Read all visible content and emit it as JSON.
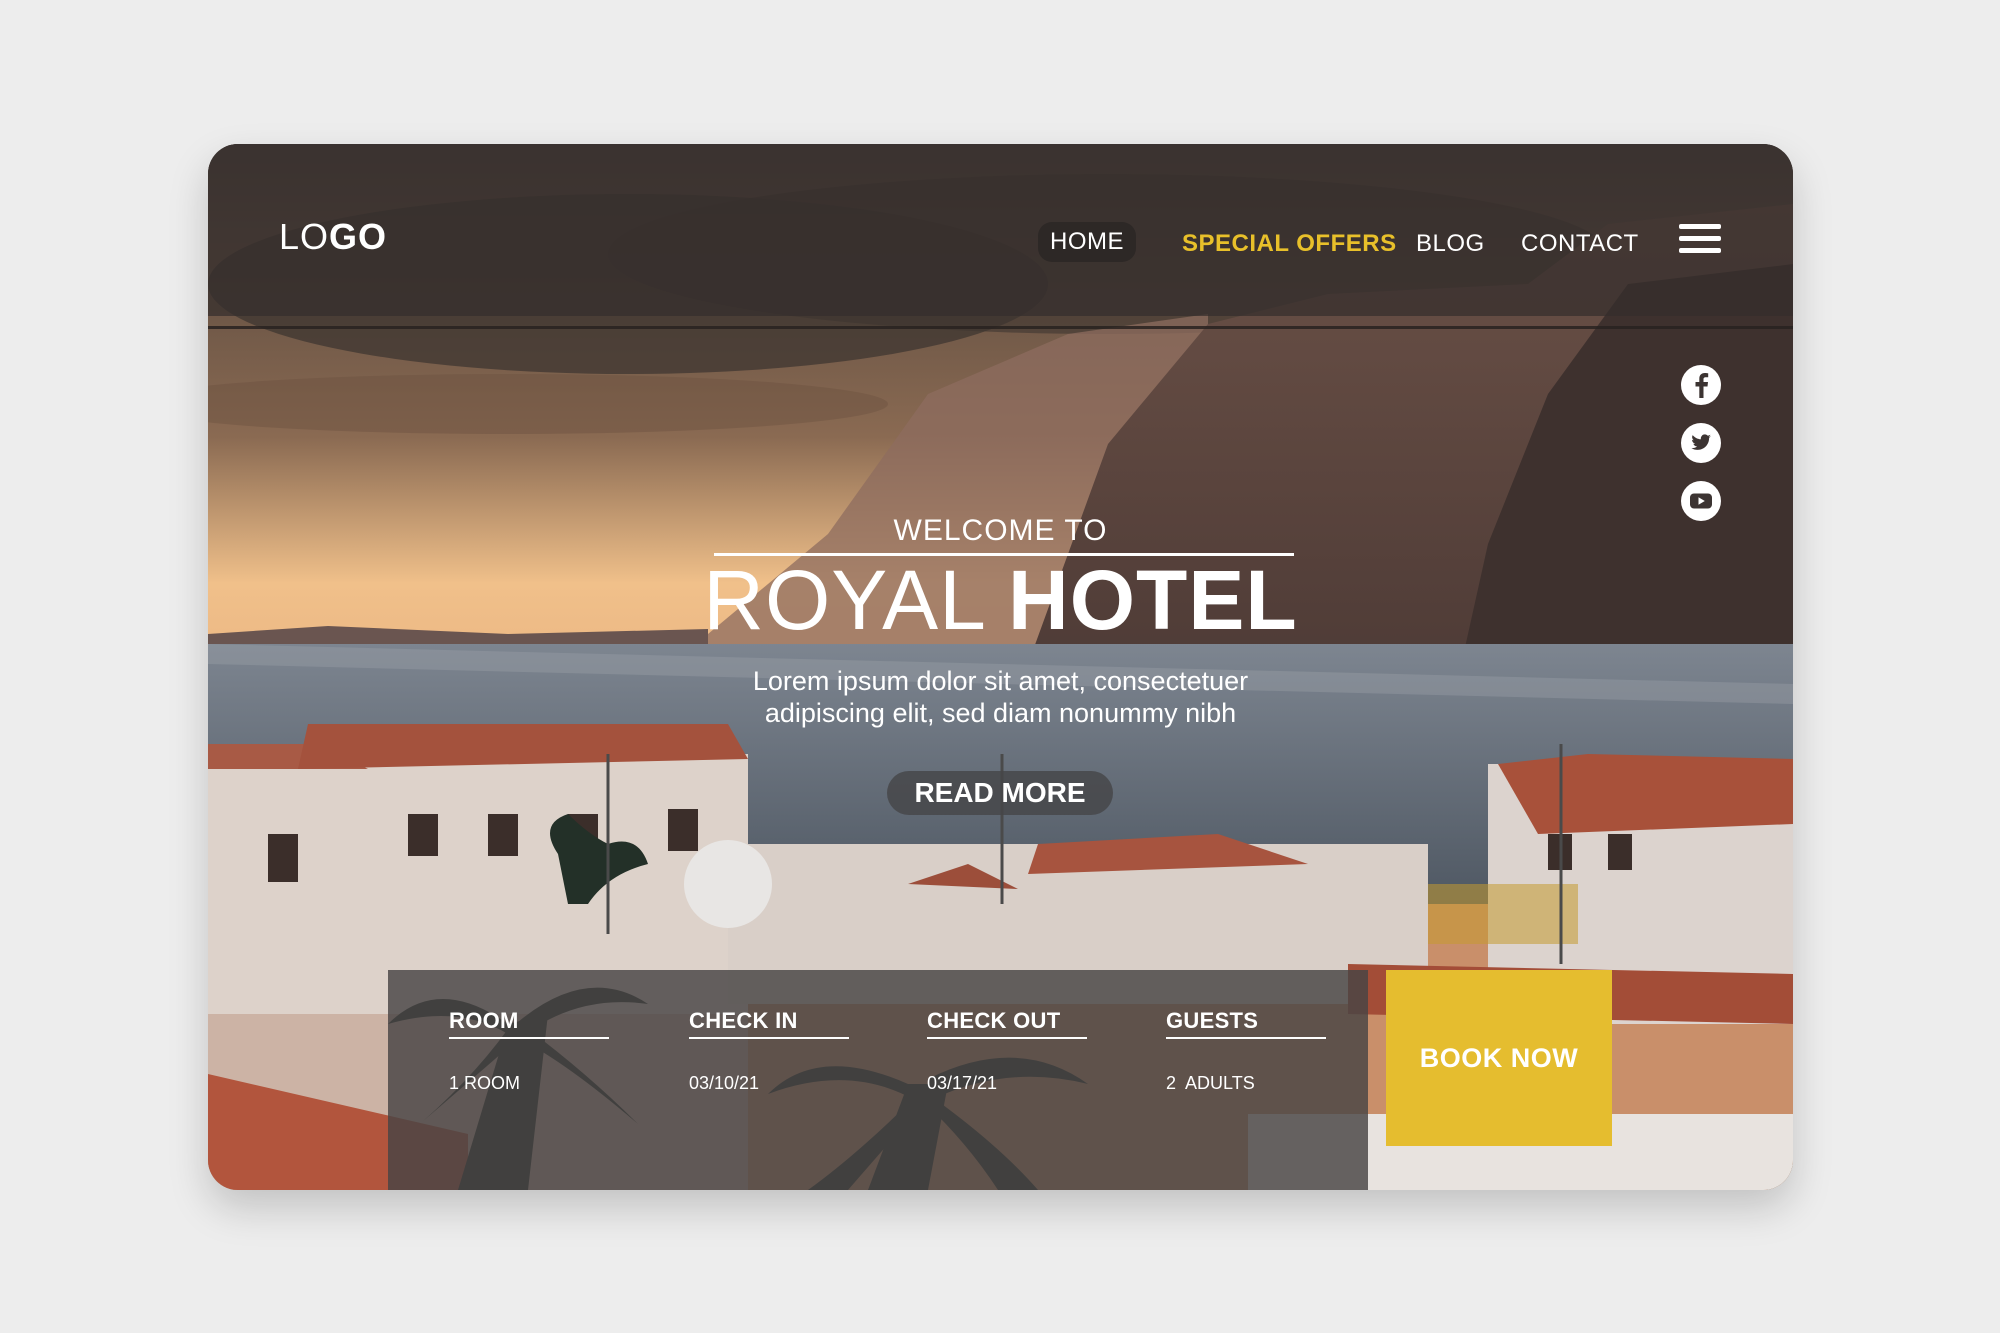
{
  "header": {
    "logo_light": "LO",
    "logo_bold": "GO",
    "nav": [
      "HOME",
      "SPECIAL OFFERS",
      "BLOG",
      "CONTACT"
    ],
    "active_nav": "HOME",
    "accent_color": "#e8c02a"
  },
  "social": [
    "facebook-icon",
    "twitter-icon",
    "youtube-icon"
  ],
  "hero": {
    "welcome": "WELCOME TO",
    "title_light": "ROYAL ",
    "title_bold": "HOTEL",
    "lead_line1": "Lorem ipsum dolor sit amet, consectetuer",
    "lead_line2": "adipiscing elit, sed diam nonummy nibh",
    "cta": "READ MORE"
  },
  "booking": {
    "fields": [
      {
        "label": "ROOM",
        "value": "1 ROOM"
      },
      {
        "label": "CHECK IN",
        "value": "03/10/21"
      },
      {
        "label": "CHECK OUT",
        "value": "03/17/21"
      },
      {
        "label": "GUESTS",
        "value": "2  ADULTS"
      }
    ],
    "button": "BOOK NOW",
    "button_color": "#e5bd2f"
  }
}
